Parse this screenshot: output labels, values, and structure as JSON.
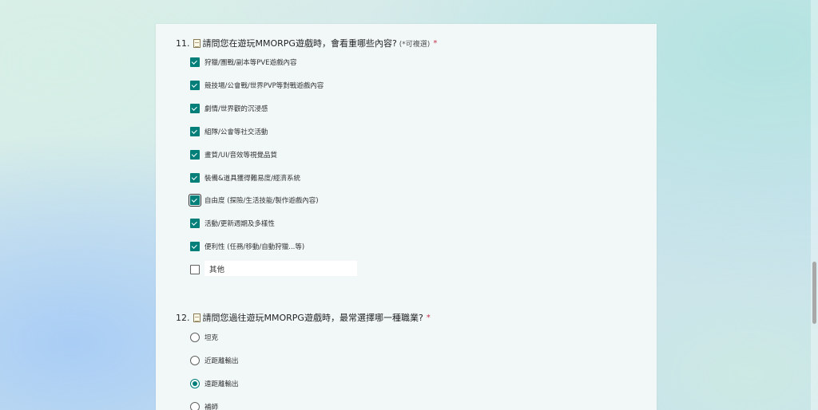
{
  "q11": {
    "number": "11.",
    "icon": "memo-icon",
    "text": "請問您在遊玩MMORPG遊戲時，會看重哪些內容?",
    "hint": "(*可複選)",
    "required": "*",
    "options": [
      {
        "label": "狩獵/團戰/副本等PVE遊戲內容",
        "checked": true
      },
      {
        "label": "競技場/公會戰/世界PVP等對戰遊戲內容",
        "checked": true
      },
      {
        "label": "劇情/世界觀的沉浸感",
        "checked": true
      },
      {
        "label": "組隊/公會等社交活動",
        "checked": true
      },
      {
        "label": "畫質/UI/音效等視覺品質",
        "checked": true
      },
      {
        "label": "裝備&道具獲得難易度/經濟系統",
        "checked": true
      },
      {
        "label": "自由度 (探險/生活技能/製作遊戲內容)",
        "checked": true,
        "focused": true
      },
      {
        "label": "活動/更新週期及多樣性",
        "checked": true
      },
      {
        "label": "便利性 (任務/移動/自動狩獵...等)",
        "checked": true
      }
    ],
    "other": {
      "checked": false,
      "placeholder": "其他"
    }
  },
  "q12": {
    "number": "12.",
    "icon": "memo-icon",
    "text": "請問您過往遊玩MMORPG遊戲時，最常選擇哪一種職業?",
    "required": "*",
    "options": [
      {
        "label": "坦克",
        "selected": false
      },
      {
        "label": "近距離輸出",
        "selected": false
      },
      {
        "label": "遠距離輸出",
        "selected": true
      },
      {
        "label": "補師",
        "selected": false
      }
    ]
  },
  "colors": {
    "accent": "#037f7a",
    "required": "#c4314b",
    "card": "#f2f8f8"
  }
}
